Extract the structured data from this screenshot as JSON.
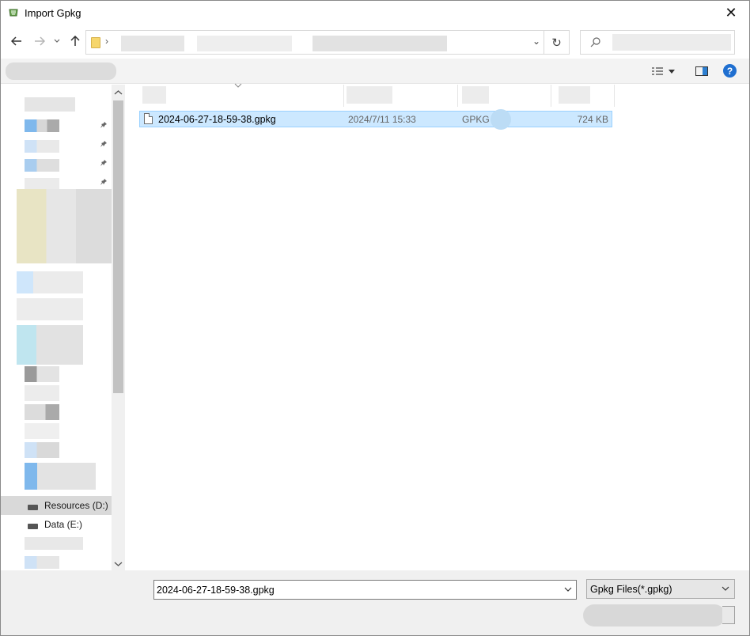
{
  "window": {
    "title": "Import Gpkg",
    "close_glyph": "✕"
  },
  "nav": {
    "back_icon": "arrow-left-icon",
    "forward_icon": "arrow-right-icon",
    "recent_icon": "chevron-down-icon",
    "up_icon": "arrow-up-icon",
    "address_separator": "›",
    "address_dropdown": "⌄",
    "refresh_glyph": "↻",
    "search_placeholder": ""
  },
  "sidebar": {
    "drives": [
      {
        "label": "Resources (D:)",
        "selected": true
      },
      {
        "label": "Data (E:)",
        "selected": false
      }
    ],
    "pin_glyph": "📌"
  },
  "files": [
    {
      "name": "2024-06-27-18-59-38.gpkg",
      "modified": "2024/7/11 15:33",
      "type": "GPKG",
      "size": "724 KB"
    }
  ],
  "footer": {
    "filename_value": "2024-06-27-18-59-38.gpkg",
    "filter_label": "Gpkg Files(*.gpkg)"
  },
  "colors": {
    "selection": "#cce8ff",
    "selection_border": "#99d1ff",
    "help": "#1f6fd0"
  }
}
